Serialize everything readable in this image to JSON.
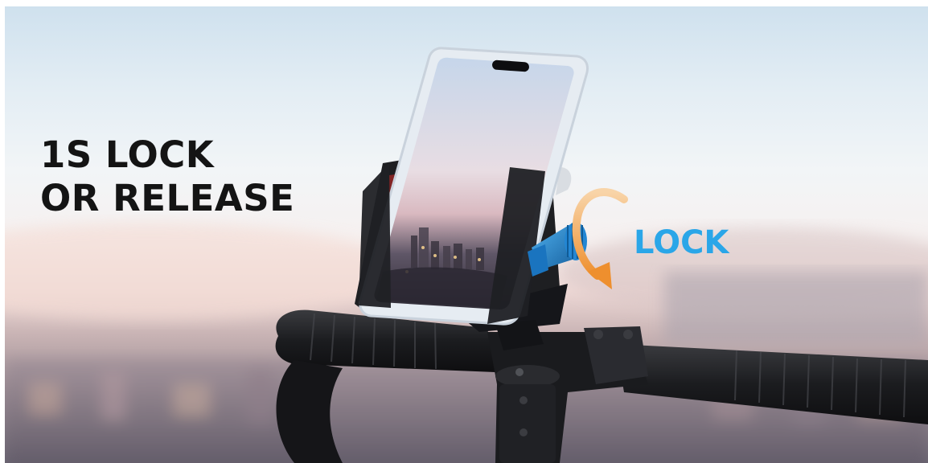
{
  "image": {
    "headline": {
      "line1": "1S LOCK",
      "line2": "OR RELEASE"
    },
    "callout": {
      "label": "LOCK",
      "color": "#2aa6e8",
      "arrow_color": "#f2a14a",
      "arrow_icon": "rotate-arrow-icon"
    },
    "colors": {
      "headline_text": "#141414",
      "knob": "#1f86d1",
      "mount_body": "#1e1f22"
    }
  }
}
